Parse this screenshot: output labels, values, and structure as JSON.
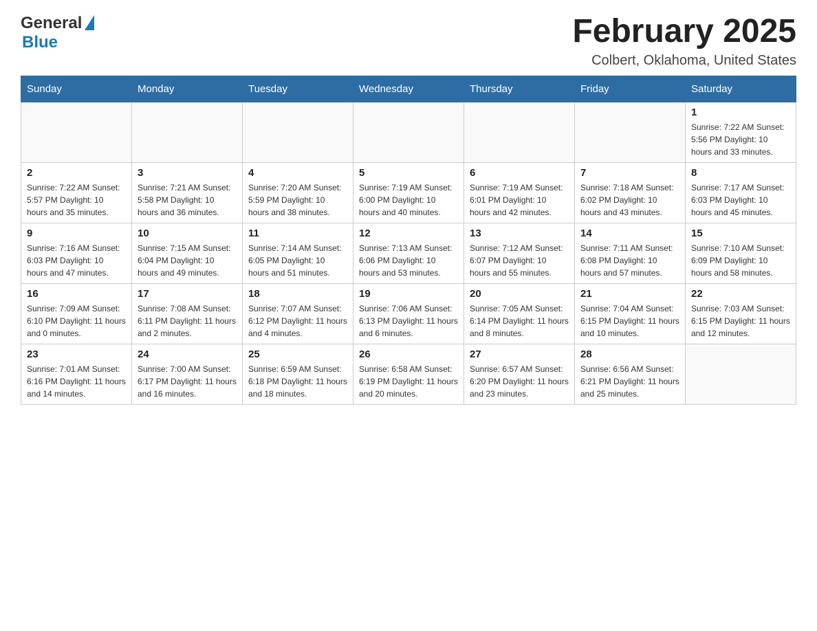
{
  "header": {
    "logo_general": "General",
    "logo_blue": "Blue",
    "month_title": "February 2025",
    "location": "Colbert, Oklahoma, United States"
  },
  "days_of_week": [
    "Sunday",
    "Monday",
    "Tuesday",
    "Wednesday",
    "Thursday",
    "Friday",
    "Saturday"
  ],
  "weeks": [
    [
      {
        "day": "",
        "info": ""
      },
      {
        "day": "",
        "info": ""
      },
      {
        "day": "",
        "info": ""
      },
      {
        "day": "",
        "info": ""
      },
      {
        "day": "",
        "info": ""
      },
      {
        "day": "",
        "info": ""
      },
      {
        "day": "1",
        "info": "Sunrise: 7:22 AM\nSunset: 5:56 PM\nDaylight: 10 hours and 33 minutes."
      }
    ],
    [
      {
        "day": "2",
        "info": "Sunrise: 7:22 AM\nSunset: 5:57 PM\nDaylight: 10 hours and 35 minutes."
      },
      {
        "day": "3",
        "info": "Sunrise: 7:21 AM\nSunset: 5:58 PM\nDaylight: 10 hours and 36 minutes."
      },
      {
        "day": "4",
        "info": "Sunrise: 7:20 AM\nSunset: 5:59 PM\nDaylight: 10 hours and 38 minutes."
      },
      {
        "day": "5",
        "info": "Sunrise: 7:19 AM\nSunset: 6:00 PM\nDaylight: 10 hours and 40 minutes."
      },
      {
        "day": "6",
        "info": "Sunrise: 7:19 AM\nSunset: 6:01 PM\nDaylight: 10 hours and 42 minutes."
      },
      {
        "day": "7",
        "info": "Sunrise: 7:18 AM\nSunset: 6:02 PM\nDaylight: 10 hours and 43 minutes."
      },
      {
        "day": "8",
        "info": "Sunrise: 7:17 AM\nSunset: 6:03 PM\nDaylight: 10 hours and 45 minutes."
      }
    ],
    [
      {
        "day": "9",
        "info": "Sunrise: 7:16 AM\nSunset: 6:03 PM\nDaylight: 10 hours and 47 minutes."
      },
      {
        "day": "10",
        "info": "Sunrise: 7:15 AM\nSunset: 6:04 PM\nDaylight: 10 hours and 49 minutes."
      },
      {
        "day": "11",
        "info": "Sunrise: 7:14 AM\nSunset: 6:05 PM\nDaylight: 10 hours and 51 minutes."
      },
      {
        "day": "12",
        "info": "Sunrise: 7:13 AM\nSunset: 6:06 PM\nDaylight: 10 hours and 53 minutes."
      },
      {
        "day": "13",
        "info": "Sunrise: 7:12 AM\nSunset: 6:07 PM\nDaylight: 10 hours and 55 minutes."
      },
      {
        "day": "14",
        "info": "Sunrise: 7:11 AM\nSunset: 6:08 PM\nDaylight: 10 hours and 57 minutes."
      },
      {
        "day": "15",
        "info": "Sunrise: 7:10 AM\nSunset: 6:09 PM\nDaylight: 10 hours and 58 minutes."
      }
    ],
    [
      {
        "day": "16",
        "info": "Sunrise: 7:09 AM\nSunset: 6:10 PM\nDaylight: 11 hours and 0 minutes."
      },
      {
        "day": "17",
        "info": "Sunrise: 7:08 AM\nSunset: 6:11 PM\nDaylight: 11 hours and 2 minutes."
      },
      {
        "day": "18",
        "info": "Sunrise: 7:07 AM\nSunset: 6:12 PM\nDaylight: 11 hours and 4 minutes."
      },
      {
        "day": "19",
        "info": "Sunrise: 7:06 AM\nSunset: 6:13 PM\nDaylight: 11 hours and 6 minutes."
      },
      {
        "day": "20",
        "info": "Sunrise: 7:05 AM\nSunset: 6:14 PM\nDaylight: 11 hours and 8 minutes."
      },
      {
        "day": "21",
        "info": "Sunrise: 7:04 AM\nSunset: 6:15 PM\nDaylight: 11 hours and 10 minutes."
      },
      {
        "day": "22",
        "info": "Sunrise: 7:03 AM\nSunset: 6:15 PM\nDaylight: 11 hours and 12 minutes."
      }
    ],
    [
      {
        "day": "23",
        "info": "Sunrise: 7:01 AM\nSunset: 6:16 PM\nDaylight: 11 hours and 14 minutes."
      },
      {
        "day": "24",
        "info": "Sunrise: 7:00 AM\nSunset: 6:17 PM\nDaylight: 11 hours and 16 minutes."
      },
      {
        "day": "25",
        "info": "Sunrise: 6:59 AM\nSunset: 6:18 PM\nDaylight: 11 hours and 18 minutes."
      },
      {
        "day": "26",
        "info": "Sunrise: 6:58 AM\nSunset: 6:19 PM\nDaylight: 11 hours and 20 minutes."
      },
      {
        "day": "27",
        "info": "Sunrise: 6:57 AM\nSunset: 6:20 PM\nDaylight: 11 hours and 23 minutes."
      },
      {
        "day": "28",
        "info": "Sunrise: 6:56 AM\nSunset: 6:21 PM\nDaylight: 11 hours and 25 minutes."
      },
      {
        "day": "",
        "info": ""
      }
    ]
  ]
}
